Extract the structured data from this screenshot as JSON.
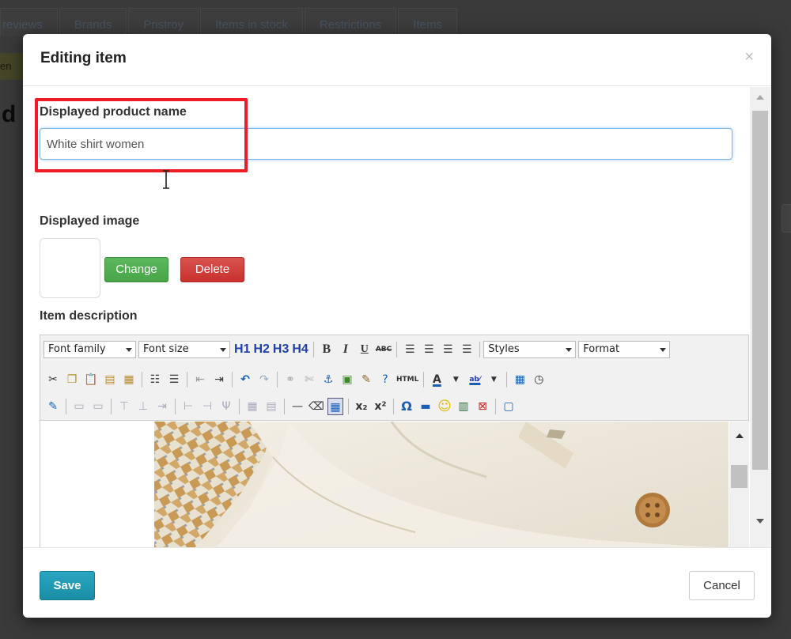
{
  "background": {
    "tabs": [
      "reviews",
      "Brands",
      "Pristroy",
      "Items in stock",
      "Restrictions",
      "Items"
    ],
    "left_badge": "en",
    "big_letter": "d"
  },
  "modal": {
    "title": "Editing item",
    "close_icon": "×",
    "product_name_label": "Displayed product name",
    "product_name_value": "White shirt women",
    "image_label": "Displayed image",
    "change_button": "Change",
    "delete_button": "Delete",
    "description_label": "Item description",
    "highlight_color": "#ee1c25",
    "save_button": "Save",
    "cancel_button": "Cancel"
  },
  "editor": {
    "font_family_label": "Font family",
    "font_size_label": "Font size",
    "styles_label": "Styles",
    "format_label": "Format",
    "headings": [
      "H1",
      "H2",
      "H3",
      "H4"
    ],
    "bold": "B",
    "italic": "I",
    "underline": "U",
    "strike": "ABC",
    "html_label": "HTML",
    "omega": "Ω",
    "text_color_letter": "A",
    "highlight_text": "ab⁄"
  }
}
